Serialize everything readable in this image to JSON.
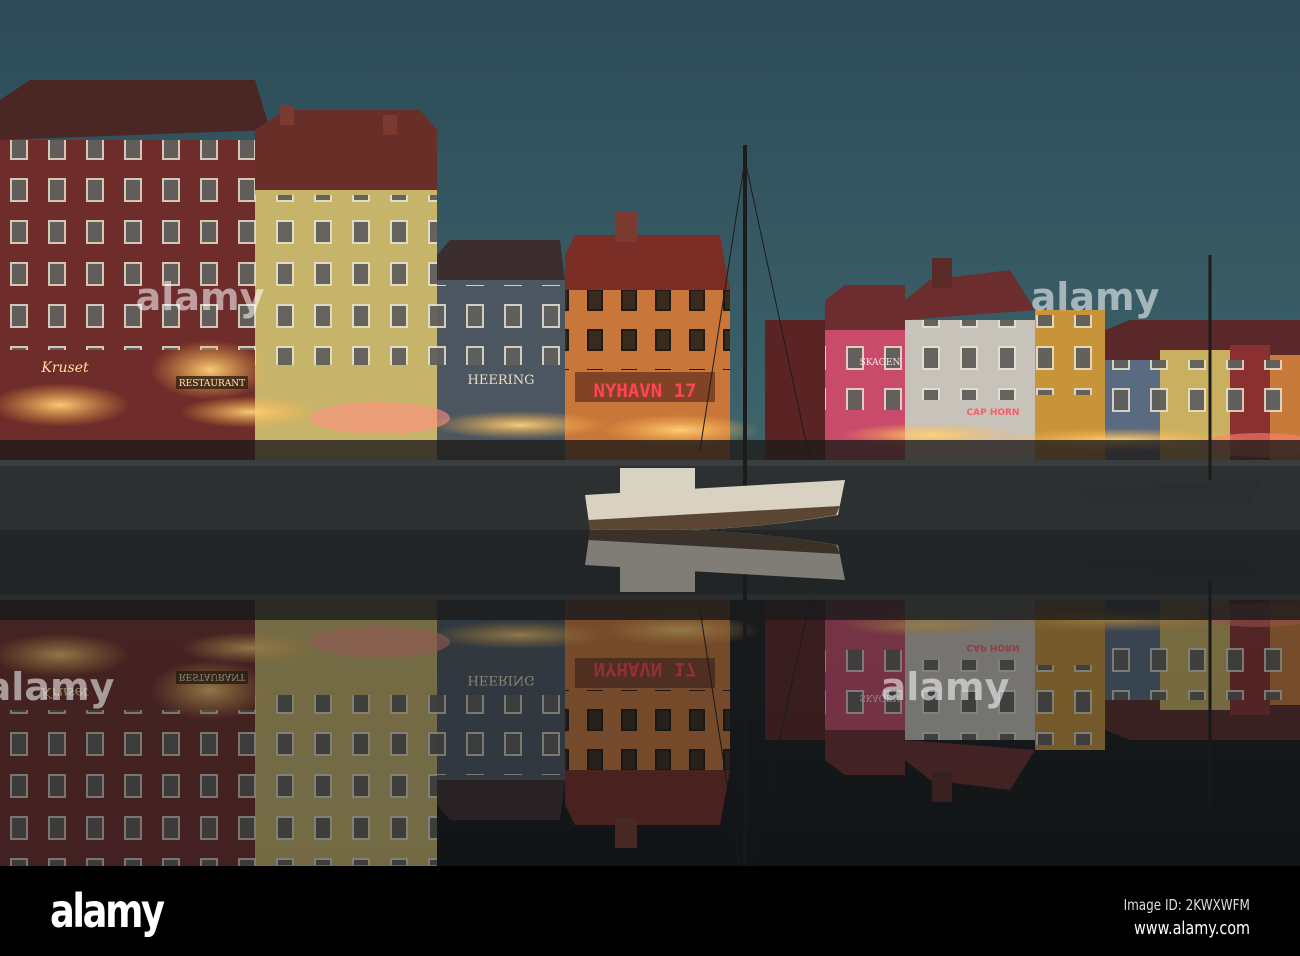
{
  "photo": {
    "signs": {
      "nyhavn": "NYHAVN 17",
      "heering": "HEERING",
      "skagen": "SKAGEN",
      "cap_horn": "CAP HORN",
      "restaurant": "RESTAURANT",
      "krusjet": "Kruset"
    },
    "colors": {
      "sky_top": "#2c4b57",
      "sky_bottom": "#3f6671",
      "water": "#15191b",
      "neon": "#ff3b4e"
    }
  },
  "watermark": {
    "brand": "alamy"
  },
  "footer": {
    "logo": "alamy",
    "image_id": "Image ID: 2KWXWFM",
    "url": "www.alamy.com"
  }
}
